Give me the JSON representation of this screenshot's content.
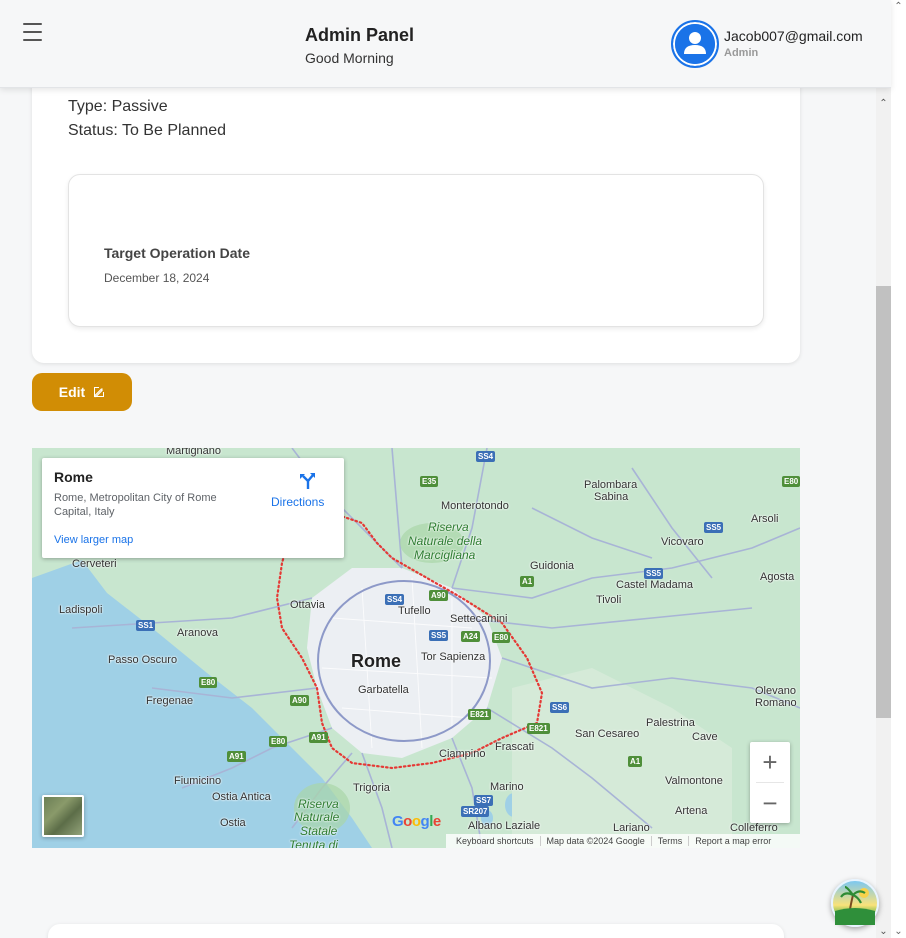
{
  "header": {
    "title": "Admin Panel",
    "subtitle": "Good Morning",
    "email": "Jacob007@gmail.com",
    "role": "Admin"
  },
  "details": {
    "type": "Type: Passive",
    "status": "Status: To Be Planned",
    "target_label": "Target Operation Date",
    "target_date": "December 18, 2024"
  },
  "edit_label": "Edit",
  "map": {
    "place_name": "Rome",
    "address": "Rome, Metropolitan City of Rome Capital, Italy",
    "view_larger": "View larger map",
    "directions": "Directions",
    "zoom_in": "+",
    "zoom_out": "−",
    "attribution": [
      "Keyboard shortcuts",
      "Map data ©2024 Google",
      "Terms",
      "Report a map error"
    ],
    "google": "Google",
    "places": {
      "martignano": "Martignano",
      "monterotondo": "Monterotondo",
      "palombara": "Palombara",
      "sabina": "Sabina",
      "riserva1": "Riserva",
      "riserva2": "Naturale della",
      "riserva3": "Marcigliana",
      "arsoli": "Arsoli",
      "cerveteri": "Cerveteri",
      "guidonia": "Guidonia",
      "vicovaro": "Vicovaro",
      "castelmadama": "Castel Madama",
      "agosta": "Agosta",
      "ladispoli": "Ladispoli",
      "ottavia": "Ottavia",
      "tufello": "Tufello",
      "settecamini": "Settecamini",
      "tivoli": "Tivoli",
      "aranova": "Aranova",
      "passooscuro": "Passo Oscuro",
      "rome": "Rome",
      "torsapienza": "Tor Sapienza",
      "garbatella": "Garbatella",
      "fregenae": "Fregenae",
      "olevano": "Olevano",
      "romano": "Romano",
      "palestrina": "Palestrina",
      "sancesareo": "San Cesareo",
      "cave": "Cave",
      "frascati": "Frascati",
      "ciampino": "Ciampino",
      "fiumicino": "Fiumicino",
      "valmontone": "Valmontone",
      "marino": "Marino",
      "trigoria": "Trigoria",
      "ostiaantica": "Ostia Antica",
      "riservastat1": "Riserva",
      "riservastat2": "Naturale",
      "riservastat3": "Statale",
      "riservastat4": "Tenuta di",
      "artena": "Artena",
      "ostia": "Ostia",
      "albano": "Albano Laziale",
      "lariano": "Lariano",
      "colleferro": "Colleferro"
    },
    "shields": {
      "ss4": "SS4",
      "e35": "E35",
      "e80a": "E80",
      "ss5a": "SS5",
      "a1a": "A1",
      "ss5b": "SS5",
      "ss4b": "SS4",
      "a90a": "A90",
      "ss1": "SS1",
      "ss5c": "SS5",
      "a24": "A24",
      "e80b": "E80",
      "e80c": "E80",
      "a90b": "A90",
      "e821a": "E821",
      "ss6": "SS6",
      "e821b": "E821",
      "e80d": "E80",
      "a91a": "A91",
      "a91b": "A91",
      "a1b": "A1",
      "ss7": "SS7",
      "sr207": "SR207"
    }
  }
}
